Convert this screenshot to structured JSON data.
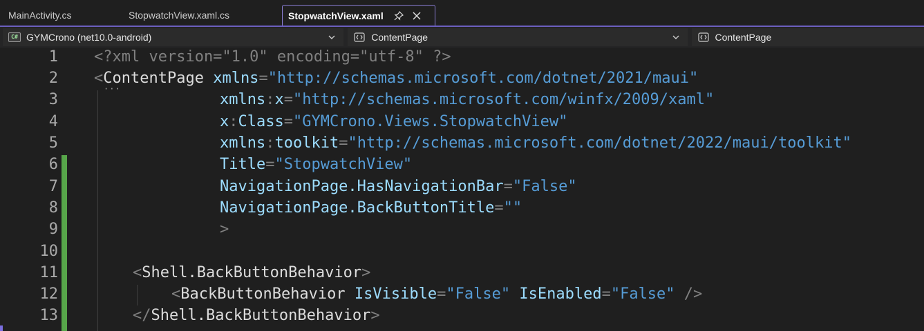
{
  "tabs": [
    {
      "label": "MainActivity.cs"
    },
    {
      "label": "StopwatchView.xaml.cs"
    },
    {
      "label": "StopwatchView.xaml",
      "active": true
    }
  ],
  "navbar": {
    "project": {
      "label": "GYMCrono (net10.0-android)",
      "icon": "csharp-icon"
    },
    "type": {
      "label": "ContentPage",
      "icon": "class-icon"
    },
    "member": {
      "label": "ContentPage",
      "icon": "class-icon"
    }
  },
  "line_numbers": [
    "1",
    "2",
    "3",
    "4",
    "5",
    "6",
    "7",
    "8",
    "9",
    "10",
    "11",
    "12",
    "13"
  ],
  "code": {
    "l1": "<?xml version=\"1.0\" encoding=\"utf-8\" ?>",
    "l2": {
      "open": "<",
      "el": "ContentPage",
      "attr": "xmlns",
      "eq": "=",
      "val": "\"http://schemas.microsoft.com/dotnet/2021/maui\""
    },
    "l3": {
      "attr1": "xmlns",
      "colon": ":",
      "attr2": "x",
      "eq": "=",
      "val": "\"http://schemas.microsoft.com/winfx/2009/xaml\""
    },
    "l4": {
      "attr1": "x",
      "colon": ":",
      "attr2": "Class",
      "eq": "=",
      "val": "\"GYMCrono.Views.StopwatchView\""
    },
    "l5": {
      "attr1": "xmlns",
      "colon": ":",
      "attr2": "toolkit",
      "eq": "=",
      "val": "\"http://schemas.microsoft.com/dotnet/2022/maui/toolkit\""
    },
    "l6": {
      "attr": "Title",
      "eq": "=",
      "val": "\"StopwatchView\""
    },
    "l7": {
      "attr": "NavigationPage.HasNavigationBar",
      "eq": "=",
      "val": "\"False\""
    },
    "l8": {
      "attr": "NavigationPage.BackButtonTitle",
      "eq": "=",
      "val": "\"\""
    },
    "l9": ">",
    "l11": {
      "open": "<",
      "el": "Shell.BackButtonBehavior",
      "close": ">"
    },
    "l12": {
      "open": "<",
      "el": "BackButtonBehavior",
      "a1": "IsVisible",
      "eq1": "=",
      "v1": "\"False\"",
      "a2": "IsEnabled",
      "eq2": "=",
      "v2": "\"False\"",
      "end": " />"
    },
    "l13": {
      "open": "</",
      "el": "Shell.BackButtonBehavior",
      "close": ">"
    }
  },
  "colors": {
    "background": "#1f1f1f",
    "changebar": "#57a64a",
    "accent": "#6c5fbf"
  }
}
